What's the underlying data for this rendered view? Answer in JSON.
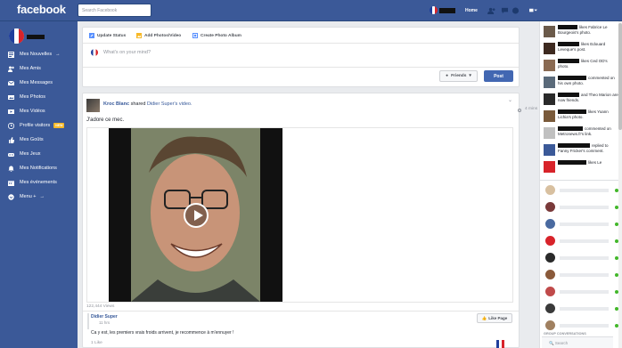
{
  "topbar": {
    "logo": "facebook",
    "search_placeholder": "Search Facebook",
    "home_label": "Home",
    "icons": [
      "friend-requests-icon",
      "messages-icon",
      "notifications-icon",
      "account-menu-icon"
    ]
  },
  "sidebar": {
    "items": [
      {
        "label": "Mes Nouvelles",
        "suffix": "→",
        "icon": "news-feed-icon"
      },
      {
        "label": "Mes Amis",
        "icon": "friends-icon"
      },
      {
        "label": "Mes Messages",
        "icon": "messages-icon"
      },
      {
        "label": "Mes Photos",
        "icon": "photos-icon"
      },
      {
        "label": "Mes Vidéos",
        "icon": "videos-icon"
      },
      {
        "label": "Profile visitors",
        "badge": "NEW",
        "icon": "visitors-icon"
      },
      {
        "label": "Mes Goûts",
        "icon": "likes-icon"
      },
      {
        "label": "Mes Jeux",
        "icon": "games-icon"
      },
      {
        "label": "Mes Notifications",
        "icon": "notifications-icon"
      },
      {
        "label": "Mes événements",
        "icon": "events-icon"
      },
      {
        "label": "Menu +",
        "suffix": "→",
        "icon": "menu-icon"
      }
    ]
  },
  "composer": {
    "tabs": [
      "Update Status",
      "Add Photos/Video",
      "Create Photo Album"
    ],
    "placeholder": "What's on your mind?",
    "audience": "Friends",
    "post_label": "Post"
  },
  "post": {
    "author": "Kroc Blanc",
    "action": "shared",
    "link": "Didier Super's video.",
    "text": "J'adore ce mec.",
    "views": "122,444 Views",
    "shared_author": "Didier Super",
    "shared_time": "11 hrs",
    "like_page_label": "Like Page",
    "shared_text": "Ca y est, les premiers vrais froids arrivent, je recommence à m'ennuyer !",
    "likes": "1 Like",
    "timestamp": "4 mins"
  },
  "ticker": [
    {
      "text": "likes Fabrice Le Bourgeois's photo."
    },
    {
      "text": "likes Edouard Leveque's post."
    },
    {
      "text": "likes Ced OD's photo."
    },
    {
      "text": "commented on his own photo."
    },
    {
      "text": "and Theo Marion are now friends."
    },
    {
      "text": "likes Yoann Lichia's photo."
    },
    {
      "text": "commented on Metronews.fr's link."
    },
    {
      "text": "replied to Fanny Fricker's comment."
    },
    {
      "text": "likes Le"
    }
  ],
  "chat": {
    "title": "GROUP CONVERSATIONS",
    "search_placeholder": "Search"
  },
  "colors": {
    "brand": "#3b5998",
    "button_blue": "#4267b2",
    "online": "#42b72a",
    "background": "#e9ebee"
  }
}
